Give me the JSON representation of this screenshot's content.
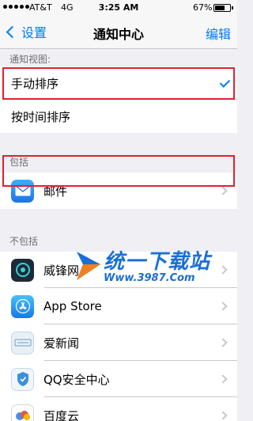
{
  "status_bar": {
    "carrier": "AT&T",
    "network": "4G",
    "time": "3:25 AM",
    "battery_percent": "67%",
    "battery_level": 0.67
  },
  "nav": {
    "back_label": "设置",
    "title": "通知中心",
    "edit_label": "编辑"
  },
  "notification_view": {
    "header": "通知视图:",
    "options": [
      {
        "label": "手动排序",
        "selected": true
      },
      {
        "label": "按时间排序",
        "selected": false
      }
    ]
  },
  "include": {
    "header": "包括",
    "apps": [
      {
        "name": "邮件",
        "icon": "mail-icon",
        "color": "#1e90ff"
      }
    ]
  },
  "not_include": {
    "header": "不包括",
    "apps": [
      {
        "name": "威锋网",
        "icon": "weiphone-icon",
        "color": "#1c2b3a"
      },
      {
        "name": "App Store",
        "icon": "app-store-icon",
        "color": "#1e8ff0"
      },
      {
        "name": "爱新闻",
        "icon": "news-icon",
        "color": "#e8f0f6"
      },
      {
        "name": "QQ安全中心",
        "icon": "qq-security-icon",
        "color": "#3a8fe0"
      },
      {
        "name": "百度云",
        "icon": "baidu-cloud-icon",
        "color": "#4a90e2"
      }
    ]
  },
  "watermark": {
    "title": "统一下载站",
    "url": "Www.3987.Com"
  },
  "colors": {
    "accent": "#007aff",
    "highlight": "#e02030",
    "background": "#efeff4"
  }
}
